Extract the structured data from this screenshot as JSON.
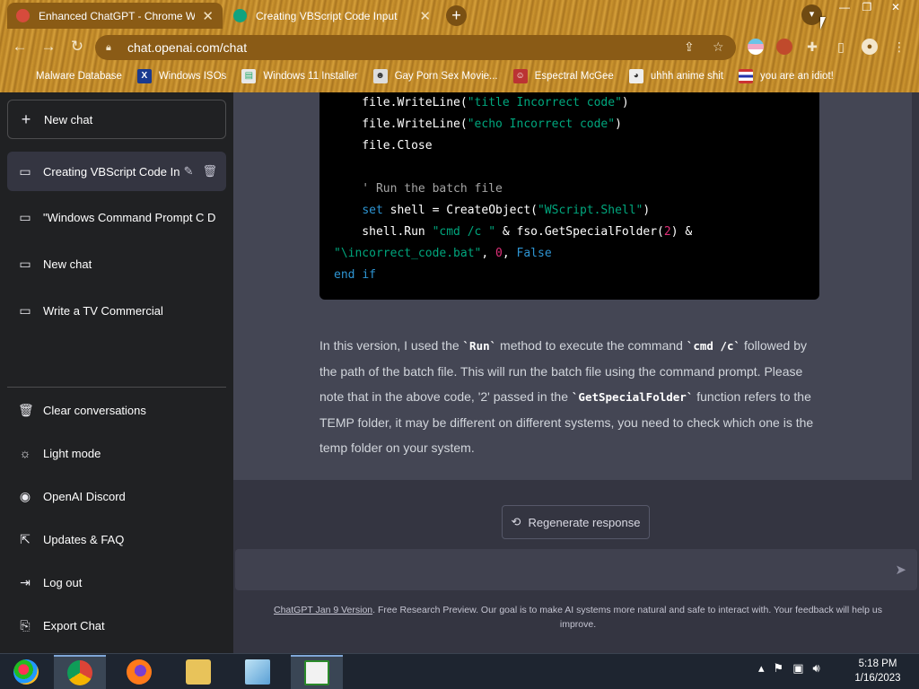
{
  "browser": {
    "tabs": [
      {
        "title": "Enhanced ChatGPT - Chrome Web",
        "favicon_color": "#d64b3c",
        "active": true
      },
      {
        "title": "Creating VBScript Code Input",
        "favicon_color": "#10a37f",
        "active": false
      }
    ],
    "new_tab_symbol": "+",
    "window_controls": [
      "—",
      "❐",
      "✕"
    ],
    "url": "chat.openai.com/chat",
    "bookmarks": [
      {
        "label": "Malware Database",
        "icon": "blank-icon"
      },
      {
        "label": "Windows ISOs",
        "icon": "x-logo-icon"
      },
      {
        "label": "Windows 11 Installer",
        "icon": "image-icon"
      },
      {
        "label": "Gay Porn Sex Movie...",
        "icon": "mask-icon"
      },
      {
        "label": "Espectral McGee",
        "icon": "avatar-icon"
      },
      {
        "label": "uhhh anime shit",
        "icon": "anime-icon"
      },
      {
        "label": "you are an idiot!",
        "icon": "flag-icon"
      }
    ]
  },
  "sidebar": {
    "new_chat": "New chat",
    "conversations": [
      {
        "label": "Creating VBScript Code In",
        "active": true
      },
      {
        "label": "\"Windows Command Prompt C D",
        "active": false
      },
      {
        "label": "New chat",
        "active": false
      },
      {
        "label": "Write a TV Commercial",
        "active": false
      }
    ],
    "menu": [
      {
        "label": "Clear conversations",
        "icon": "trash-icon"
      },
      {
        "label": "Light mode",
        "icon": "sun-icon"
      },
      {
        "label": "OpenAI Discord",
        "icon": "discord-icon"
      },
      {
        "label": "Updates & FAQ",
        "icon": "external-link-icon"
      },
      {
        "label": "Log out",
        "icon": "logout-icon"
      },
      {
        "label": "Export Chat",
        "icon": "export-icon"
      }
    ]
  },
  "code_lines": [
    "    file.WriteLine(\"title Incorrect code\")",
    "    file.WriteLine(\"echo Incorrect code\")",
    "    file.Close",
    "",
    "    ' Run the batch file",
    "    set shell = CreateObject(\"WScript.Shell\")",
    "    shell.Run \"cmd /c \" & fso.GetSpecialFolder(2) &",
    "\"\\incorrect_code.bat\", 0, False",
    "end if"
  ],
  "prose": {
    "p1": "In this version, I used the ",
    "c1": "`Run`",
    "p2": " method to execute the command ",
    "c2": "`cmd /c`",
    "p3": " followed by the path of the batch file. This will run the batch file using the command prompt. Please note that in the above code, '2' passed in the ",
    "c3": "`GetSpecialFolder`",
    "p4": " function refers to the TEMP folder, it may be different on different systems, you need to check which one is the temp folder on your system."
  },
  "regenerate_label": "Regenerate response",
  "composer": {
    "placeholder": ""
  },
  "footer": {
    "link": "ChatGPT Jan 9 Version",
    "text": ". Free Research Preview. Our goal is to make AI systems more natural and safe to interact with. Your feedback will help us improve."
  },
  "taskbar": {
    "time": "5:18 PM",
    "date": "1/16/2023",
    "apps": [
      "start-orb-icon",
      "chrome-icon",
      "firefox-icon",
      "explorer-icon",
      "notepad-icon",
      "editor-icon"
    ]
  },
  "colors": {
    "sidebar": "#202123",
    "main": "#343541",
    "answer": "#444654",
    "code_string": "#00a67d",
    "code_keyword": "#2e95d3",
    "code_number": "#df3079"
  }
}
